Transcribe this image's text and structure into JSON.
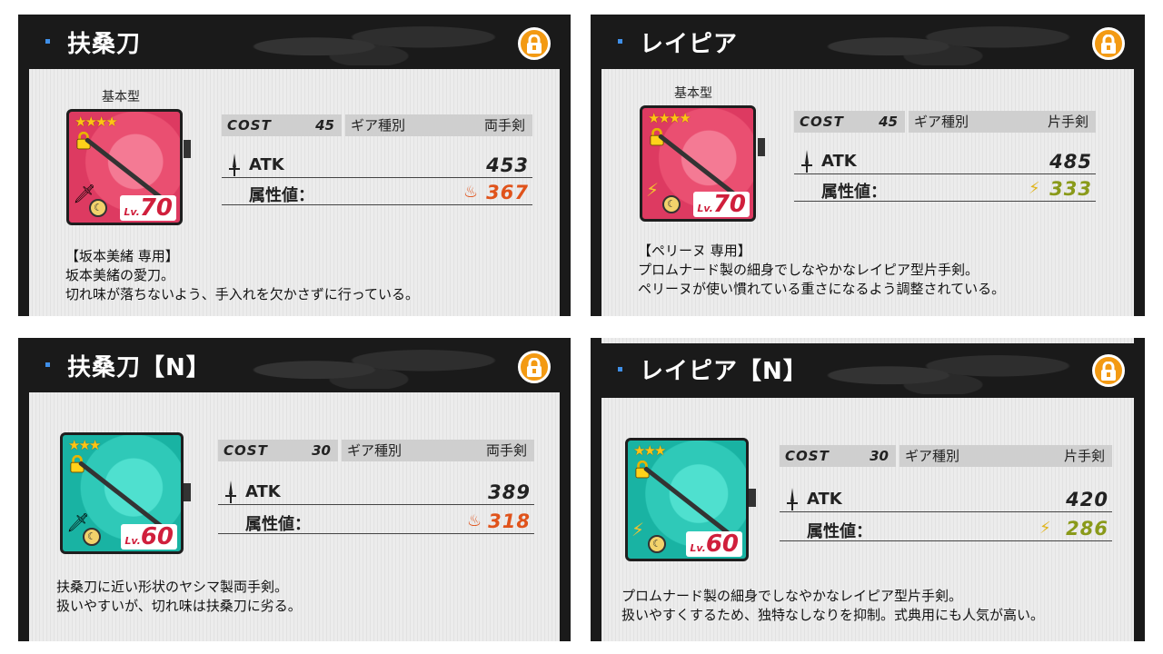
{
  "cards": [
    {
      "title": "扶桑刀",
      "base_label": "基本型",
      "color": "#ea4f71",
      "stars": "★★★★",
      "level_prefix": "Lv.",
      "level": "70",
      "cost_label": "COST",
      "cost": "45",
      "gear_type_label": "ギア種別",
      "gear_type": "両手剣",
      "atk_label": "ATK",
      "atk": "453",
      "attr_label": "属性値：",
      "attr_element": "fire",
      "attr_value": "367",
      "desc": [
        "【坂本美緒 専用】",
        "坂本美緒の愛刀。",
        "切れ味が落ちないよう、手入れを欠かさずに行っている。"
      ]
    },
    {
      "title": "レイピア",
      "base_label": "基本型",
      "color": "#ea4f71",
      "stars": "★★★★",
      "level_prefix": "Lv.",
      "level": "70",
      "cost_label": "COST",
      "cost": "45",
      "gear_type_label": "ギア種別",
      "gear_type": "片手剣",
      "atk_label": "ATK",
      "atk": "485",
      "attr_label": "属性値：",
      "attr_element": "lightning",
      "attr_value": "333",
      "desc": [
        "【ペリーヌ 専用】",
        "プロムナード製の細身でしなやかなレイピア型片手剣。",
        "ペリーヌが使い慣れている重さになるよう調整されている。"
      ]
    },
    {
      "title": "扶桑刀【N】",
      "color": "#2fc9b8",
      "stars": "★★★",
      "level_prefix": "Lv.",
      "level": "60",
      "cost_label": "COST",
      "cost": "30",
      "gear_type_label": "ギア種別",
      "gear_type": "両手剣",
      "atk_label": "ATK",
      "atk": "389",
      "attr_label": "属性値：",
      "attr_element": "fire",
      "attr_value": "318",
      "desc": [
        "扶桑刀に近い形状のヤシマ製両手剣。",
        "扱いやすいが、切れ味は扶桑刀に劣る。"
      ]
    },
    {
      "title": "レイピア【N】",
      "color": "#2fc9b8",
      "stars": "★★★",
      "level_prefix": "Lv.",
      "level": "60",
      "cost_label": "COST",
      "cost": "30",
      "gear_type_label": "ギア種別",
      "gear_type": "片手剣",
      "atk_label": "ATK",
      "atk": "420",
      "attr_label": "属性値：",
      "attr_element": "lightning",
      "attr_value": "286",
      "desc": [
        "プロムナード製の細身でしなやかなレイピア型片手剣。",
        "扱いやすくするため、独特なしなりを抑制。式典用にも人気が高い。"
      ]
    }
  ]
}
